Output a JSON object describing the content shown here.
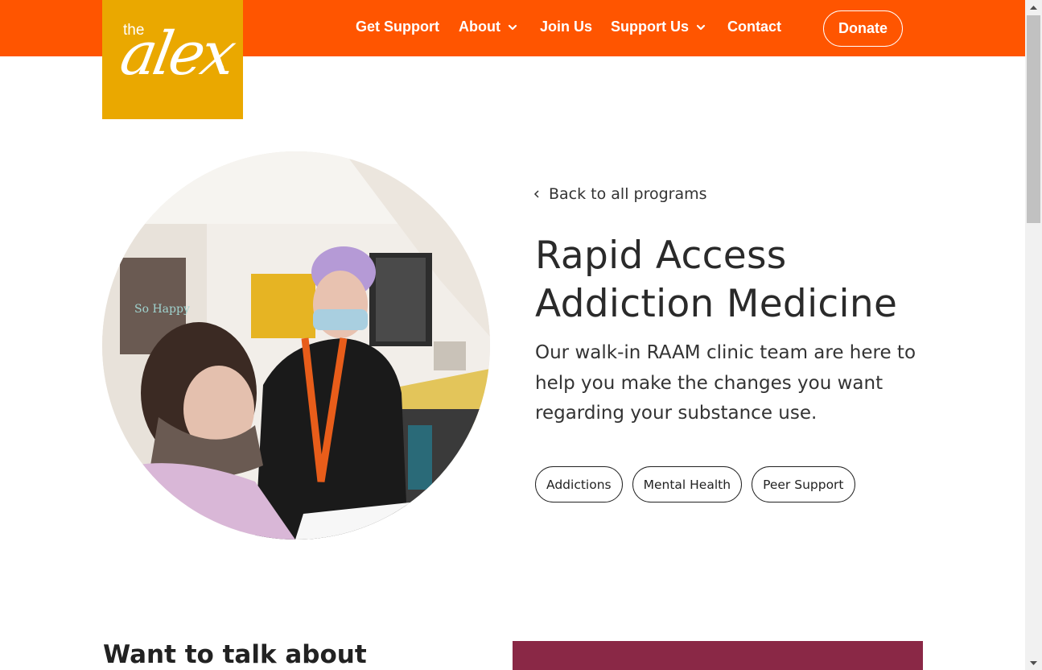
{
  "brand": {
    "logo_small": "the",
    "logo_main": "alex"
  },
  "nav": {
    "items": [
      {
        "label": "Get Support",
        "dropdown": false
      },
      {
        "label": "About",
        "dropdown": true
      },
      {
        "label": "Join Us",
        "dropdown": false
      },
      {
        "label": "Support Us",
        "dropdown": true
      },
      {
        "label": "Contact",
        "dropdown": false
      }
    ],
    "donate_label": "Donate"
  },
  "program": {
    "back_label": "Back to all programs",
    "title_line1": "Rapid Access",
    "title_line2": "Addiction Medicine",
    "description": "Our walk-in RAAM clinic team are here to help you make the changes you want regarding your substance use.",
    "tags": [
      "Addictions",
      "Mental Health",
      "Peer Support"
    ]
  },
  "section2": {
    "heading": "Want to talk about"
  },
  "colors": {
    "header": "#ff5500",
    "logo_bg": "#eaa800",
    "maroon": "#8a2846"
  },
  "icons": [
    "chevron-down-icon",
    "chevron-left-icon"
  ]
}
